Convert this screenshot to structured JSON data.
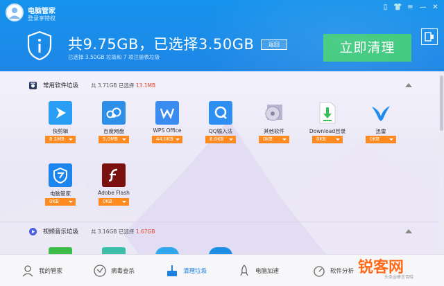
{
  "header": {
    "app_title": "电脑管家",
    "login_link": "登录享特权",
    "summary_title": "共9.75GB，已选择3.50GB",
    "back_label": "返回",
    "summary_sub": "已选择 3.50GB 垃圾和 7 项注册表垃圾",
    "clean_label": "立即清理",
    "window_icons": [
      "phone-icon",
      "shirt-icon",
      "menu-icon",
      "minimize-icon",
      "close-icon"
    ]
  },
  "sections": [
    {
      "title": "常用软件垃圾",
      "info_prefix": "共 3.71GB 已选择",
      "info_selected": "13.1MB",
      "apps": [
        {
          "name": "快剪辑",
          "size": "8.1MB",
          "color": "#2a9df4",
          "icon": "play-icon"
        },
        {
          "name": "百度网盘",
          "size": "5.0MB",
          "color": "#2e8fe8",
          "icon": "cloud-icon"
        },
        {
          "name": "WPS Office",
          "size": "44.0KB",
          "color": "#3b8cf0",
          "icon": "wps-icon"
        },
        {
          "name": "QQ输入法",
          "size": "8.0KB",
          "color": "#2d8ff2",
          "icon": "q-icon"
        },
        {
          "name": "其他软件",
          "size": "0KB",
          "color": "#c9c7d8",
          "icon": "disc-icon"
        },
        {
          "name": "Download目录",
          "size": "0KB",
          "color": "#ffffff",
          "icon": "download-icon"
        },
        {
          "name": "迅雷",
          "size": "0KB",
          "color": "#ffffff",
          "icon": "bird-icon"
        },
        {
          "name": "电脑管家",
          "size": "0KB",
          "color": "#1d86ee",
          "icon": "shield-icon"
        },
        {
          "name": "Adobe Flash",
          "size": "0KB",
          "color": "#7a1010",
          "icon": "flash-icon"
        }
      ]
    },
    {
      "title": "视频音乐垃圾",
      "info_prefix": "共 3.16GB 已选择",
      "info_selected": "1.67GB"
    }
  ],
  "bottom_nav": [
    {
      "label": "我的管家",
      "icon": "person-icon",
      "active": false
    },
    {
      "label": "病毒查杀",
      "icon": "virus-scan-icon",
      "active": false
    },
    {
      "label": "清理垃圾",
      "icon": "broom-icon",
      "active": true
    },
    {
      "label": "电脑加速",
      "icon": "rocket-icon",
      "active": false
    },
    {
      "label": "软件分析",
      "icon": "speedometer-icon",
      "active": false
    }
  ],
  "watermark": {
    "text": "锐客网",
    "sub": "头条@蜂言百晓"
  },
  "colors": {
    "header_blue": "#1693ec",
    "clean_green": "#39c87a",
    "size_orange": "#ff8a1f",
    "selected_red": "#e7432c",
    "active_blue": "#1b7fe3"
  }
}
